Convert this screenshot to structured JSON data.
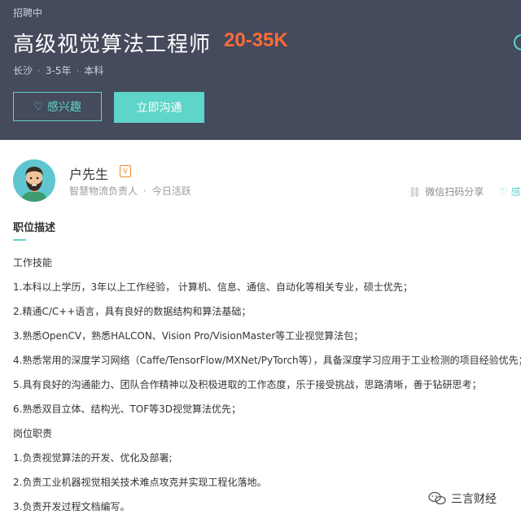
{
  "header": {
    "status": "招聘中",
    "title": "高级视觉算法工程师",
    "salary": "20-35K",
    "meta": [
      "长沙",
      "3-5年",
      "本科"
    ],
    "interest_label": "感兴趣",
    "chat_label": "立即沟通",
    "colors": {
      "bg": "#454a5c",
      "accent": "#5dd5c8",
      "salary": "#fc6c38"
    }
  },
  "recruiter": {
    "name": "户先生",
    "badge": "V",
    "company_role": "智慧物流负责人",
    "activity": "今日活跃",
    "share_label": "微信扫码分享",
    "fav_label": "感"
  },
  "description": {
    "section_title": "职位描述",
    "lines": [
      "工作技能",
      "1.本科以上学历，3年以上工作经验， 计算机、信息、通信、自动化等相关专业，硕士优先；",
      "2.精通C/C++语言，具有良好的数据结构和算法基础；",
      "3.熟悉OpenCV，熟悉HALCON、Vision Pro/VisionMaster等工业视觉算法包；",
      "4.熟悉常用的深度学习网络（Caffe/TensorFlow/MXNet/PyTorch等），具备深度学习应用于工业检测的项目经验优先；",
      "5.具有良好的沟通能力、团队合作精神以及积极进取的工作态度，乐于接受挑战，思路清晰，善于钻研思考；",
      "6.熟悉双目立体、结构光、TOF等3D视觉算法优先；",
      "岗位职责",
      "1.负责视觉算法的开发、优化及部署;",
      "2.负责工业机器视觉相关技术难点攻克并实现工程化落地。",
      "3.负责开发过程文档编写。"
    ]
  },
  "watermark": {
    "text": "三言财经"
  }
}
